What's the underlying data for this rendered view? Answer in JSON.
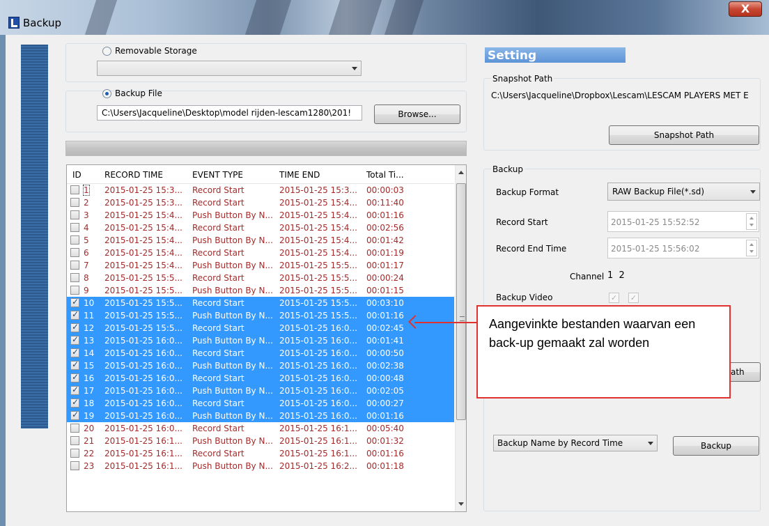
{
  "window": {
    "title": "Backup",
    "close_glyph": "X"
  },
  "left": {
    "removable_storage_label": "Removable Storage",
    "removable_storage_value": "",
    "backup_file_label": "Backup File",
    "backup_file_path": "C:\\Users\\Jacqueline\\Desktop\\model rijden-lescam1280\\201!",
    "browse_label": "Browse..."
  },
  "table": {
    "columns": [
      "ID",
      "RECORD TIME",
      "EVENT TYPE",
      "TIME END",
      "Total Ti..."
    ],
    "rows": [
      {
        "id": "1",
        "record_time": "2015-01-25 15:3...",
        "event_type": "Record Start",
        "time_end": "2015-01-25 15:3...",
        "total": "00:00:03",
        "checked": false,
        "selected": false
      },
      {
        "id": "2",
        "record_time": "2015-01-25 15:3...",
        "event_type": "Record Start",
        "time_end": "2015-01-25 15:4...",
        "total": "00:11:40",
        "checked": false,
        "selected": false
      },
      {
        "id": "3",
        "record_time": "2015-01-25 15:4...",
        "event_type": "Push Button By N...",
        "time_end": "2015-01-25 15:4...",
        "total": "00:01:16",
        "checked": false,
        "selected": false
      },
      {
        "id": "4",
        "record_time": "2015-01-25 15:4...",
        "event_type": "Record Start",
        "time_end": "2015-01-25 15:4...",
        "total": "00:02:56",
        "checked": false,
        "selected": false
      },
      {
        "id": "5",
        "record_time": "2015-01-25 15:4...",
        "event_type": "Push Button By N...",
        "time_end": "2015-01-25 15:4...",
        "total": "00:01:42",
        "checked": false,
        "selected": false
      },
      {
        "id": "6",
        "record_time": "2015-01-25 15:4...",
        "event_type": "Record Start",
        "time_end": "2015-01-25 15:4...",
        "total": "00:01:19",
        "checked": false,
        "selected": false
      },
      {
        "id": "7",
        "record_time": "2015-01-25 15:4...",
        "event_type": "Push Button By N...",
        "time_end": "2015-01-25 15:5...",
        "total": "00:01:17",
        "checked": false,
        "selected": false
      },
      {
        "id": "8",
        "record_time": "2015-01-25 15:5...",
        "event_type": "Record Start",
        "time_end": "2015-01-25 15:5...",
        "total": "00:00:24",
        "checked": false,
        "selected": false
      },
      {
        "id": "9",
        "record_time": "2015-01-25 15:5...",
        "event_type": "Push Button By N...",
        "time_end": "2015-01-25 15:5...",
        "total": "00:01:15",
        "checked": false,
        "selected": false
      },
      {
        "id": "10",
        "record_time": "2015-01-25 15:5...",
        "event_type": "Record Start",
        "time_end": "2015-01-25 15:5...",
        "total": "00:03:10",
        "checked": true,
        "selected": true
      },
      {
        "id": "11",
        "record_time": "2015-01-25 15:5...",
        "event_type": "Push Button By N...",
        "time_end": "2015-01-25 15:5...",
        "total": "00:01:16",
        "checked": true,
        "selected": true
      },
      {
        "id": "12",
        "record_time": "2015-01-25 15:5...",
        "event_type": "Record Start",
        "time_end": "2015-01-25 16:0...",
        "total": "00:02:45",
        "checked": true,
        "selected": true
      },
      {
        "id": "13",
        "record_time": "2015-01-25 16:0...",
        "event_type": "Push Button By N...",
        "time_end": "2015-01-25 16:0...",
        "total": "00:01:41",
        "checked": true,
        "selected": true
      },
      {
        "id": "14",
        "record_time": "2015-01-25 16:0...",
        "event_type": "Record Start",
        "time_end": "2015-01-25 16:0...",
        "total": "00:00:50",
        "checked": true,
        "selected": true
      },
      {
        "id": "15",
        "record_time": "2015-01-25 16:0...",
        "event_type": "Push Button By N...",
        "time_end": "2015-01-25 16:0...",
        "total": "00:02:38",
        "checked": true,
        "selected": true
      },
      {
        "id": "16",
        "record_time": "2015-01-25 16:0...",
        "event_type": "Record Start",
        "time_end": "2015-01-25 16:0...",
        "total": "00:00:48",
        "checked": true,
        "selected": true
      },
      {
        "id": "17",
        "record_time": "2015-01-25 16:0...",
        "event_type": "Push Button By N...",
        "time_end": "2015-01-25 16:0...",
        "total": "00:02:05",
        "checked": true,
        "selected": true
      },
      {
        "id": "18",
        "record_time": "2015-01-25 16:0...",
        "event_type": "Record Start",
        "time_end": "2015-01-25 16:0...",
        "total": "00:00:27",
        "checked": true,
        "selected": true
      },
      {
        "id": "19",
        "record_time": "2015-01-25 16:0...",
        "event_type": "Push Button By N...",
        "time_end": "2015-01-25 16:0...",
        "total": "00:01:16",
        "checked": true,
        "selected": true
      },
      {
        "id": "20",
        "record_time": "2015-01-25 16:0...",
        "event_type": "Record Start",
        "time_end": "2015-01-25 16:1...",
        "total": "00:05:40",
        "checked": false,
        "selected": false
      },
      {
        "id": "21",
        "record_time": "2015-01-25 16:1...",
        "event_type": "Push Button By N...",
        "time_end": "2015-01-25 16:1...",
        "total": "00:01:32",
        "checked": false,
        "selected": false
      },
      {
        "id": "22",
        "record_time": "2015-01-25 16:1...",
        "event_type": "Record Start",
        "time_end": "2015-01-25 16:1...",
        "total": "00:01:16",
        "checked": false,
        "selected": false
      },
      {
        "id": "23",
        "record_time": "2015-01-25 16:1...",
        "event_type": "Push Button By N...",
        "time_end": "2015-01-25 16:2...",
        "total": "00:01:18",
        "checked": false,
        "selected": false
      }
    ]
  },
  "right": {
    "setting_title": "Setting",
    "snapshot_group": "Snapshot Path",
    "snapshot_path": "C:\\Users\\Jacqueline\\Dropbox\\Lescam\\LESCAM PLAYERS MET E",
    "snapshot_button": "Snapshot Path",
    "backup_group": "Backup",
    "backup_format_label": "Backup Format",
    "backup_format_value": "RAW Backup File(*.sd)",
    "record_start_label": "Record Start",
    "record_start_value": "2015-01-25 15:52:52",
    "record_end_label": "Record End Time",
    "record_end_value": "2015-01-25 15:56:02",
    "channel_label": "Channel",
    "channel_values": "1  2",
    "backup_video_label": "Backup Video",
    "path_button_partial": "ath",
    "backup_name_value": "Backup Name by Record Time",
    "backup_button": "Backup"
  },
  "annotation": {
    "text": "Aangevinkte bestanden waarvan een back-up gemaakt zal worden",
    "color": "#e0312e"
  },
  "colors": {
    "selection": "#3399ff",
    "row_text": "#a52a2a"
  }
}
